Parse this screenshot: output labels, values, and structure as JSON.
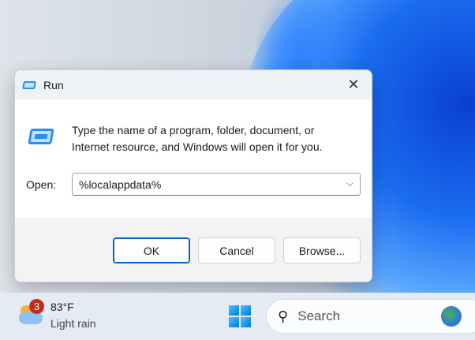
{
  "dialog": {
    "title": "Run",
    "description_line1": "Type the name of a program, folder, document, or",
    "description_line2": "Internet resource, and Windows will open it for you.",
    "open_label": "Open:",
    "open_value": "%localappdata%",
    "ok": "OK",
    "cancel": "Cancel",
    "browse": "Browse..."
  },
  "taskbar": {
    "weather_badge": "3",
    "temperature": "83°F",
    "condition": "Light rain",
    "search_label": "Search"
  }
}
